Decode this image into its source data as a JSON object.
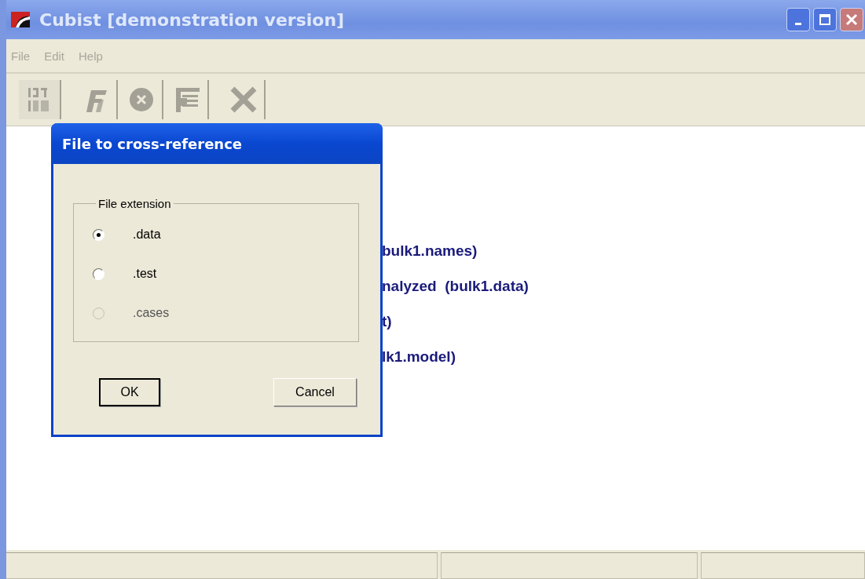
{
  "window": {
    "title": "Cubist [demonstration version]"
  },
  "menu": [
    {
      "label": "File",
      "disabled": true
    },
    {
      "label": "Edit",
      "disabled": true
    },
    {
      "label": "Help",
      "disabled": true
    }
  ],
  "toolbar": [
    {
      "kind": "digits",
      "disabled": true
    },
    {
      "kind": "ff",
      "disabled": true
    },
    {
      "kind": "stop",
      "disabled": true
    },
    {
      "kind": "list",
      "disabled": true
    },
    {
      "kind": "cross",
      "disabled": true
    }
  ],
  "content": {
    "lines": [
      "bulk1.names)",
      "nalyzed  (bulk1.data)",
      "t)",
      "lk1.model)"
    ]
  },
  "dialog": {
    "title": "File to cross-reference",
    "group": "File extension",
    "options": [
      {
        "label": ".data",
        "selected": true,
        "disabled": false
      },
      {
        "label": ".test",
        "selected": false,
        "disabled": false
      },
      {
        "label": ".cases",
        "selected": false,
        "disabled": true
      }
    ],
    "buttons": [
      {
        "label": "OK",
        "default": true
      },
      {
        "label": "Cancel",
        "default": false
      }
    ]
  }
}
